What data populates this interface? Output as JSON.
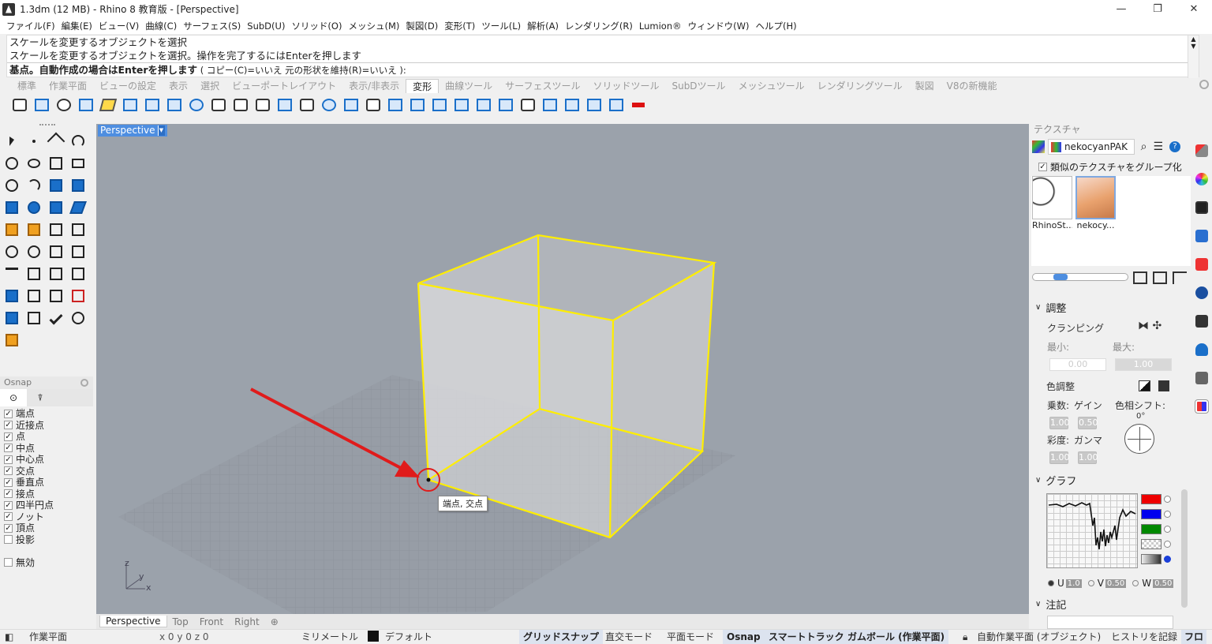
{
  "titlebar": {
    "title": "1.3dm (12 MB) - Rhino 8 教育版 - [Perspective]",
    "minimize": "—",
    "restore": "❐",
    "close": "✕"
  },
  "menu": [
    "ファイル(F)",
    "編集(E)",
    "ビュー(V)",
    "曲線(C)",
    "サーフェス(S)",
    "SubD(U)",
    "ソリッド(O)",
    "メッシュ(M)",
    "製図(D)",
    "変形(T)",
    "ツール(L)",
    "解析(A)",
    "レンダリング(R)",
    "Lumion®",
    "ウィンドウ(W)",
    "ヘルプ(H)"
  ],
  "command": {
    "history1": "スケールを変更するオブジェクトを選択",
    "history2": "スケールを変更するオブジェクトを選択。操作を完了するにはEnterを押します",
    "prompt": "基点。自動作成の場合はEnterを押します",
    "options": " ( コピー(C)=いいえ  元の形状を維持(R)=いいえ ):"
  },
  "tabs": [
    "標準",
    "作業平面",
    "ビューの設定",
    "表示",
    "選択",
    "ビューポートレイアウト",
    "表示/非表示",
    "変形",
    "曲線ツール",
    "サーフェスツール",
    "ソリッドツール",
    "SubDツール",
    "メッシュツール",
    "レンダリングツール",
    "製図",
    "V8の新機能"
  ],
  "active_tab": "変形",
  "osnap": {
    "title": "Osnap",
    "items": [
      {
        "label": "端点",
        "checked": true
      },
      {
        "label": "近接点",
        "checked": true
      },
      {
        "label": "点",
        "checked": true
      },
      {
        "label": "中点",
        "checked": true
      },
      {
        "label": "中心点",
        "checked": true
      },
      {
        "label": "交点",
        "checked": true
      },
      {
        "label": "垂直点",
        "checked": true
      },
      {
        "label": "接点",
        "checked": true
      },
      {
        "label": "四半円点",
        "checked": true
      },
      {
        "label": "ノット",
        "checked": true
      },
      {
        "label": "頂点",
        "checked": true
      },
      {
        "label": "投影",
        "checked": false
      }
    ],
    "disable": "無効"
  },
  "viewport": {
    "label": "Perspective",
    "tooltip": "端点, 交点",
    "axis_z": "z",
    "axis_y": "y",
    "axis_x": "x",
    "curve_color": "#ffee00"
  },
  "viewport_tabs": [
    "Perspective",
    "Top",
    "Front",
    "Right",
    "⊕"
  ],
  "texture_panel": {
    "title": "テクスチャ",
    "texture_name": "nekocyanPAK",
    "group_similar": "類似のテクスチャをグループ化",
    "thumbnails": [
      "RhinoSt...",
      "nekocy..."
    ],
    "adjust": "調整",
    "clamping": "クランピング",
    "min_label": "最小:",
    "max_label": "最大:",
    "min_value": "0.00",
    "max_value": "1.00",
    "color_adjust": "色調整",
    "multiply": "乗数:",
    "gain": "ゲイン",
    "hue_shift": "色相シフト:",
    "hue_value": "0°",
    "saturation": "彩度:",
    "gamma": "ガンマ",
    "val_mult": "1.00",
    "val_gain": "0.50",
    "val_sat": "1.00",
    "val_gamma": "1.00",
    "graph": "グラフ",
    "u_label": "U",
    "v_label": "V",
    "w_label": "W",
    "u_val": "1.0",
    "v_val": "0.50",
    "w_val": "0.50",
    "notes": "注記"
  },
  "status": {
    "cplane": "作業平面",
    "coords": "x 0  y 0  z 0",
    "units": "ミリメートル",
    "layer": "デフォルト",
    "grid_snap": "グリッドスナップ",
    "ortho": "直交モード",
    "planar": "平面モード",
    "osnap": "Osnap",
    "smarttrack": "スマートトラック",
    "gumball": "ガムボール (作業平面)",
    "auto_cplane": "自動作業平面 (オブジェクト)",
    "history": "ヒストリを記録",
    "filter": "フロ"
  }
}
